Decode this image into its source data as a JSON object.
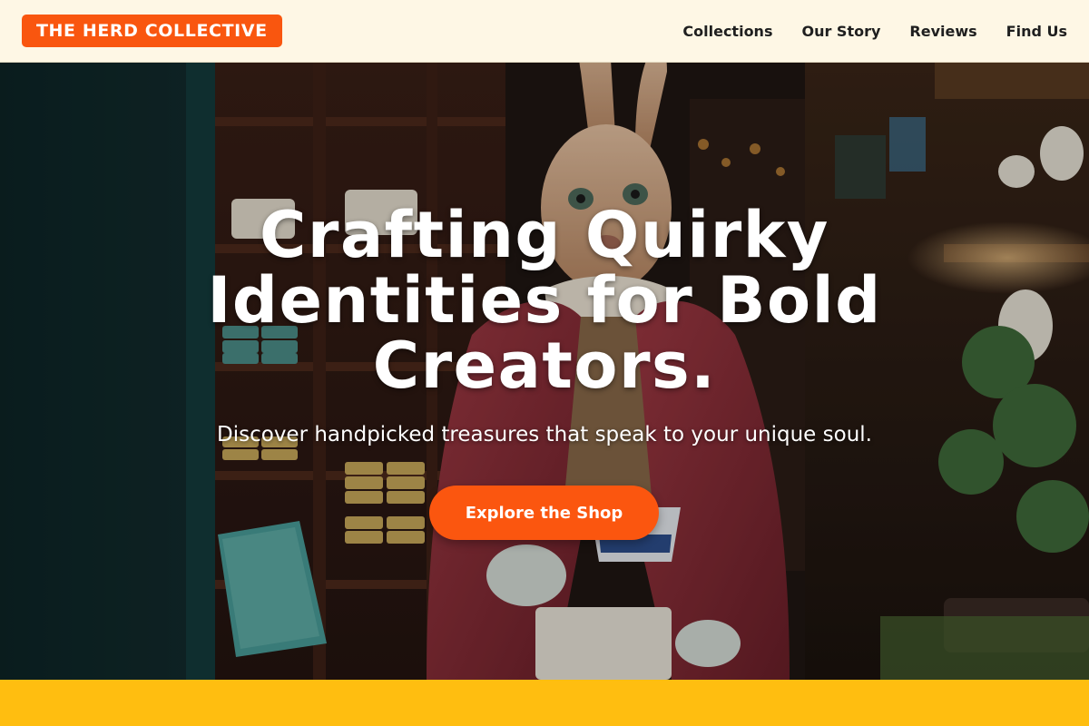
{
  "brand": {
    "name": "THE HERD COLLECTIVE",
    "color": "#f9560f"
  },
  "nav": {
    "items": [
      {
        "label": "Collections"
      },
      {
        "label": "Our Story"
      },
      {
        "label": "Reviews"
      },
      {
        "label": "Find Us"
      }
    ]
  },
  "hero": {
    "title": "Crafting Quirky Identities for Bold Creators.",
    "subtitle": "Discover handpicked treasures that speak to your unique soul.",
    "cta_label": "Explore the Shop",
    "cta_color": "#fb560f",
    "image_subject": "rabbit-figure-in-red-coat-holding-teacup-in-antique-shop"
  },
  "theme": {
    "header_bg": "#fef7e5",
    "band_color": "#ffbe10"
  }
}
